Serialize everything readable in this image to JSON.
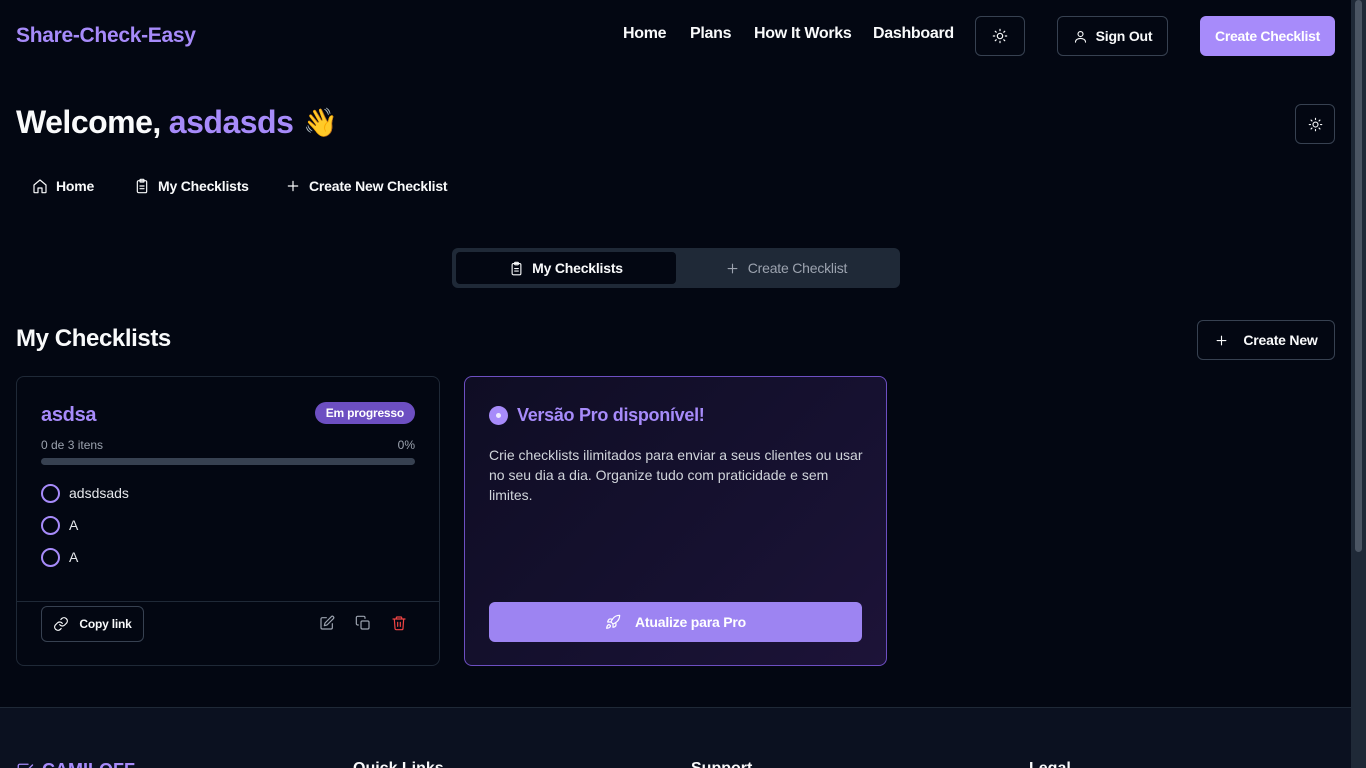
{
  "header": {
    "brand": "Share-Check-Easy",
    "nav": [
      "Home",
      "Plans",
      "How It Works",
      "Dashboard"
    ],
    "theme_icon": "sun-icon",
    "sign_out": "Sign Out",
    "create_checklist": "Create Checklist"
  },
  "welcome": {
    "prefix": "Welcome,",
    "username": "asdasds",
    "emoji": "👋"
  },
  "subnav": {
    "home": "Home",
    "my_checklists": "My Checklists",
    "create_new": "Create New Checklist"
  },
  "tabs": {
    "active": "My Checklists",
    "inactive": "Create Checklist"
  },
  "section": {
    "title": "My Checklists",
    "create_new": "Create New"
  },
  "checklist": {
    "title": "asdsa",
    "status": "Em progresso",
    "progress_text": "0 de 3 itens",
    "progress_pct": "0%",
    "progress_value": 0,
    "items": [
      {
        "label": "adsdsads",
        "checked": false
      },
      {
        "label": "A",
        "checked": false
      },
      {
        "label": "A",
        "checked": false
      }
    ],
    "copy_link": "Copy link"
  },
  "pro": {
    "title": "Versão Pro disponível!",
    "description": "Crie checklists ilimitados para enviar a seus clientes ou usar no seu dia a dia. Organize tudo com praticidade e sem limites.",
    "button": "Atualize para Pro"
  },
  "footer": {
    "brand": "CAMILOFF",
    "columns": [
      "Quick Links",
      "Support",
      "Legal"
    ]
  },
  "colors": {
    "accent": "#a78bfa",
    "background": "#030712",
    "badge": "#6d4fc2",
    "danger": "#ef4444"
  }
}
